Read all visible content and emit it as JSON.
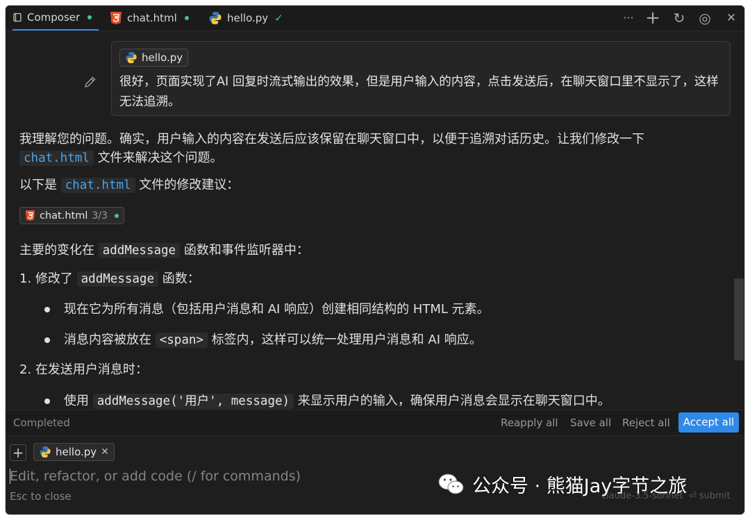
{
  "tabs": [
    {
      "label": "Composer",
      "status": "dot"
    },
    {
      "label": "chat.html",
      "status": "dot"
    },
    {
      "label": "hello.py",
      "status": "check"
    }
  ],
  "toolbar": {
    "more": "···",
    "add": "+",
    "history": "↻",
    "check": "◎",
    "close": "✕"
  },
  "user_message": {
    "attachment": "hello.py",
    "text": "很好，页面实现了AI 回复时流式输出的效果，但是用户输入的内容，点击发送后，在聊天窗口里不显示了，这样无法追溯。"
  },
  "response": {
    "p1_before": "我理解您的问题。确实，用户输入的内容在发送后应该保留在聊天窗口中，以便于追溯对话历史。让我们修改一下",
    "p1_code": "chat.html",
    "p1_after": "文件来解决这个问题。",
    "p2_before": "以下是",
    "p2_code": "chat.html",
    "p2_after": "文件的修改建议：",
    "file_chip": {
      "name": "chat.html",
      "count": "3/3"
    },
    "p3_before": "主要的变化在",
    "p3_code": "addMessage",
    "p3_after": "函数和事件监听器中：",
    "item1_before": "1. 修改了",
    "item1_code": "addMessage",
    "item1_after": "函数：",
    "bullet1": "现在它为所有消息（包括用户消息和 AI 响应）创建相同结构的 HTML 元素。",
    "bullet2_before": "消息内容被放在",
    "bullet2_code": "<span>",
    "bullet2_after": "标签内，这样可以统一处理用户消息和 AI 响应。",
    "item2": "2. 在发送用户消息时：",
    "bullet3_before": "使用",
    "bullet3_code": "addMessage('用户', message)",
    "bullet3_after": "来显示用户的输入，确保用户消息会显示在聊天窗口中。"
  },
  "status_bar": {
    "completed": "Completed",
    "reapply": "Reapply all",
    "save": "Save all",
    "reject": "Reject all",
    "accept": "Accept all"
  },
  "input": {
    "add": "+",
    "attachment": "hello.py",
    "placeholder": "Edit, refactor, or add code (/ for commands)",
    "esc_hint": "Esc to close",
    "model": "claude-3.5-sonnet",
    "submit": "⏎ submit"
  },
  "watermark": "公众号 · 熊猫Jay字节之旅",
  "colors": {
    "accent": "#2f89e8",
    "status_dot": "#4cc38a",
    "code_blue": "#4aa3f0",
    "html5": "#e44d26"
  }
}
